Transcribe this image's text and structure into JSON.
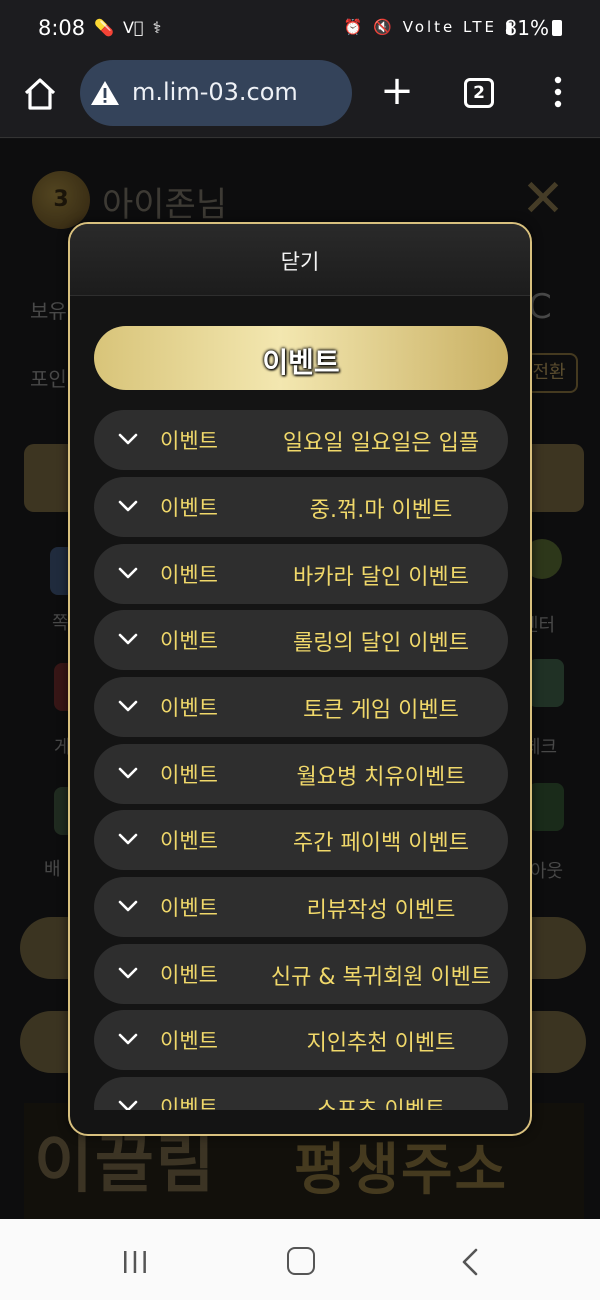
{
  "status_bar": {
    "time": "8:08",
    "left_icons": "💊 V⃣ ⚕",
    "right_icons": "⏰ 🔇 Volte LTE ▮",
    "battery": "81%"
  },
  "browser": {
    "url": "m.lim-03.com",
    "tab_count": "2",
    "new_tab_glyph": "+",
    "menu_glyph": "⋮"
  },
  "background_page": {
    "level_badge": "3",
    "username": "아이존님",
    "close_glyph": "✕",
    "label_balance": "보유",
    "label_point": "포인",
    "convert_button": "전환",
    "refresh_glyph": "C",
    "menu_labels": [
      "쪽",
      "센터",
      "게",
      "체크",
      "배",
      "아웃"
    ],
    "banner_left": "이끌림",
    "banner_top": "이끌림",
    "banner_right": "평생주소"
  },
  "modal": {
    "close_label": "닫기",
    "title": "이벤트",
    "items": [
      {
        "category": "이벤트",
        "name": "일요일 일요일은 입플"
      },
      {
        "category": "이벤트",
        "name": "중.꺾.마 이벤트"
      },
      {
        "category": "이벤트",
        "name": "바카라 달인 이벤트"
      },
      {
        "category": "이벤트",
        "name": "롤링의 달인 이벤트"
      },
      {
        "category": "이벤트",
        "name": "토큰 게임 이벤트"
      },
      {
        "category": "이벤트",
        "name": "월요병 치유이벤트"
      },
      {
        "category": "이벤트",
        "name": "주간 페이백 이벤트"
      },
      {
        "category": "이벤트",
        "name": "리뷰작성 이벤트"
      },
      {
        "category": "이벤트",
        "name": "신규 & 복귀회원 이벤트"
      },
      {
        "category": "이벤트",
        "name": "지인추천 이벤트"
      },
      {
        "category": "이벤트",
        "name": "스포츠 이벤트"
      }
    ]
  },
  "nav_bar": {
    "recent_icon": "recent-apps-icon",
    "home_icon": "home-icon",
    "back_icon": "back-icon"
  },
  "colors": {
    "gold_text": "#f0d86a",
    "modal_border": "#d8c07e",
    "item_bg": "#2e2e2e"
  }
}
